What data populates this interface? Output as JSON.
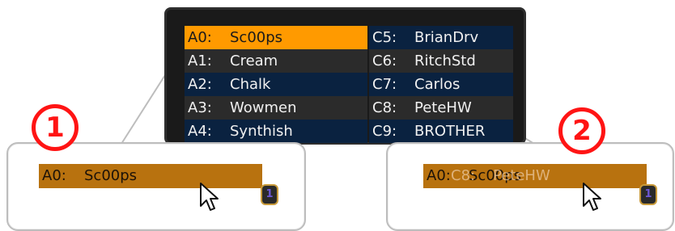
{
  "list": {
    "left_column": [
      {
        "code": "A0:",
        "name": "Sc00ps",
        "selected": true
      },
      {
        "code": "A1:",
        "name": "Cream"
      },
      {
        "code": "A2:",
        "name": "Chalk"
      },
      {
        "code": "A3:",
        "name": "Wowmen"
      },
      {
        "code": "A4:",
        "name": "Synthish"
      }
    ],
    "right_column": [
      {
        "code": "C5:",
        "name": "BrianDrv"
      },
      {
        "code": "C6:",
        "name": "RitchStd"
      },
      {
        "code": "C7:",
        "name": "Carlos"
      },
      {
        "code": "C8:",
        "name": "PeteHW"
      },
      {
        "code": "C9:",
        "name": "BROTHER"
      }
    ]
  },
  "callout_1": {
    "step_number": "1",
    "drag_item": {
      "code": "A0:",
      "name": "Sc00ps"
    },
    "badge": "1"
  },
  "callout_2": {
    "step_number": "2",
    "drag_item": {
      "code": "A0:",
      "name": "Sc00ps"
    },
    "ghost_item": {
      "code": "C8:",
      "name": "PeteHW"
    },
    "badge": "1"
  },
  "colors": {
    "selected": "#ff9a00",
    "drag": "#b8720f",
    "navy_row": "#0a2240",
    "dark_row": "#2b2b2b",
    "step_marker": "#ff1414"
  },
  "icons": [
    "mouse-pointer-icon",
    "badge-icon"
  ]
}
